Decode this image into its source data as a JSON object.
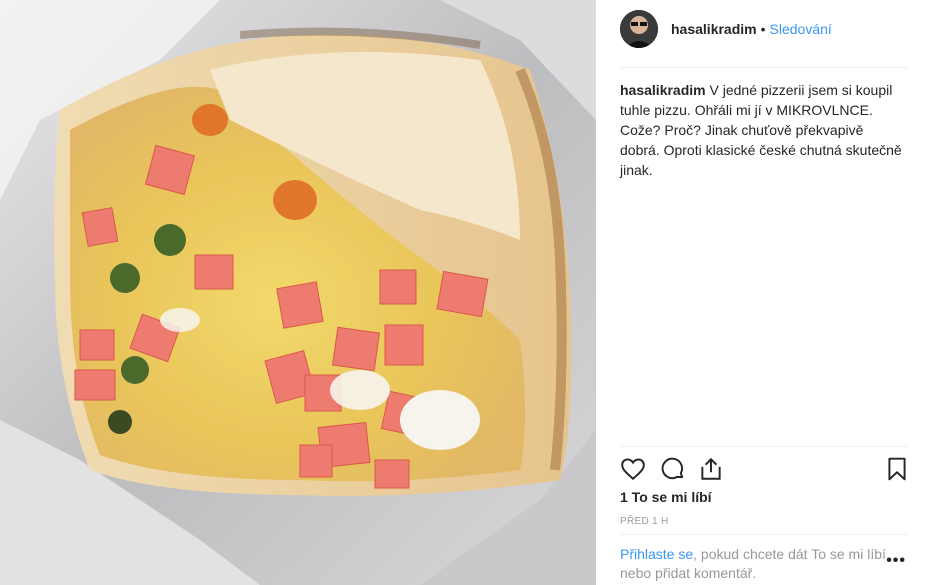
{
  "post": {
    "username": "hasalikradim",
    "dot": "•",
    "follow_label": "Sledování",
    "caption_user": "hasalikradim",
    "caption_text": "V jedné pizzerii jsem si koupil tuhle pizzu. Ohřáli mi jí v MIKROVLNCE. Cože? Proč? Jinak chuťově překvapivě dobrá. Oproti klasické české chutná skutečně jinak.",
    "likes": "1 To se mi líbí",
    "timestamp": "PŘED 1 H",
    "comment_login": "Přihlaste se",
    "comment_rest": ", pokud chcete dát To se mi líbí nebo přidat komentář.",
    "more": "•••"
  },
  "icons": [
    "heart-icon",
    "comment-icon",
    "share-icon",
    "bookmark-icon"
  ],
  "colors": {
    "link": "#3897f0",
    "text": "#262626",
    "muted": "#999999",
    "border": "#efefef"
  }
}
